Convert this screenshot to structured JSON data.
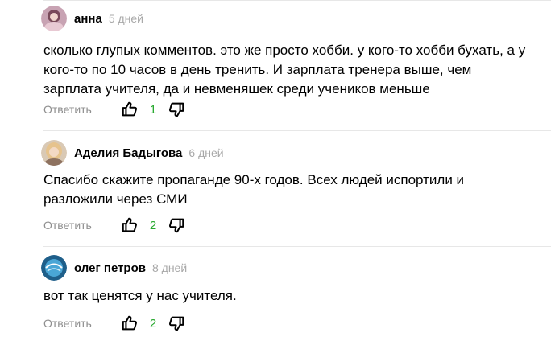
{
  "comments": [
    {
      "author": "анна",
      "date": "5 дней",
      "text": "сколько глупых комментов. это же просто хобби. у кого-то хобби бухать, а у кого-то по 10 часов в день тренить. И зарплата тренера выше, чем зарплата учителя, да и невменяшек среди учеников меньше",
      "likes": "1"
    },
    {
      "author": "Аделия Бадыгова",
      "date": "6 дней",
      "text": "Спасибо скажите пропаганде 90-х годов. Всех людей испортили и разложили через СМИ",
      "likes": "2"
    },
    {
      "author": "олег петров",
      "date": "8 дней",
      "text": "вот так ценятся у нас учителя.",
      "likes": "2"
    }
  ],
  "reply_label": "Ответить",
  "icons": {
    "like": "thumbs-up-icon",
    "dislike": "thumbs-down-icon"
  },
  "colors": {
    "like_count": "#27a82e",
    "muted": "#8f8f8f"
  }
}
